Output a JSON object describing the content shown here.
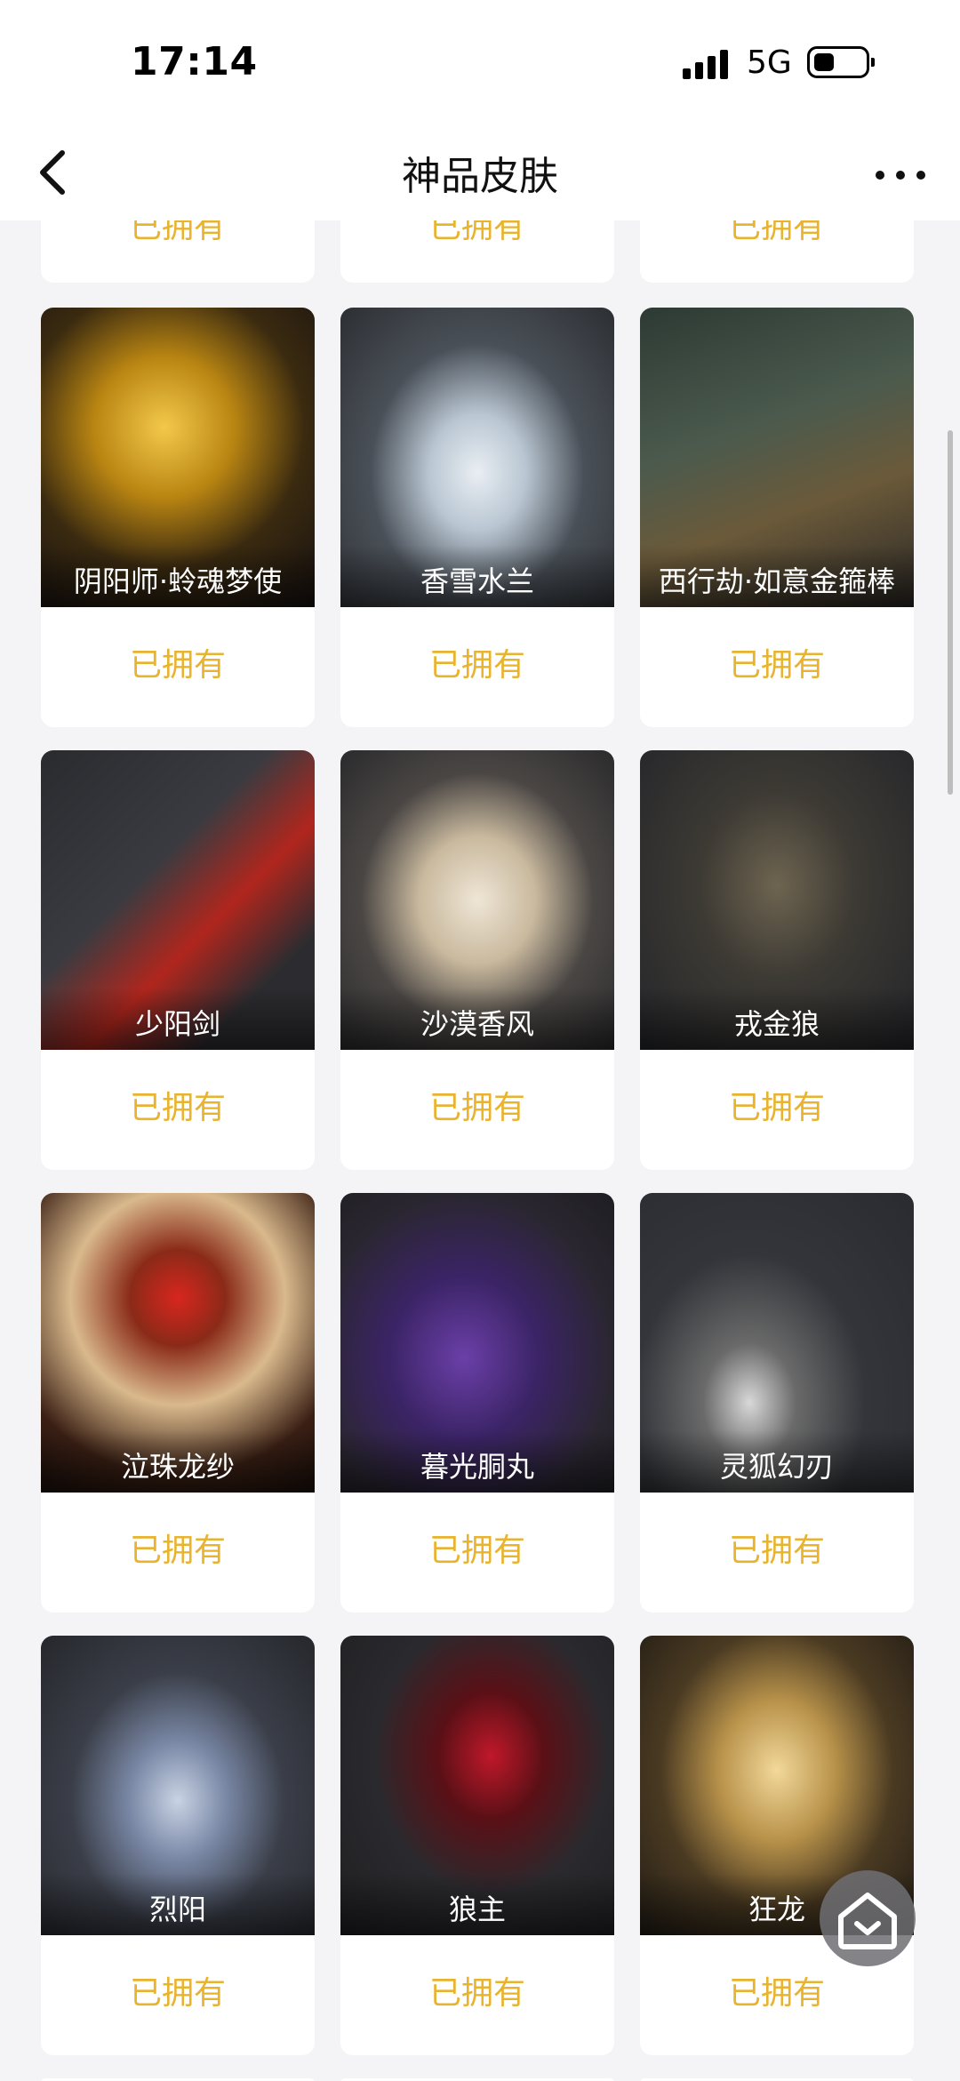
{
  "status_bar": {
    "time": "17:14",
    "network": "5G"
  },
  "nav": {
    "title": "神品皮肤"
  },
  "owned_label": "已拥有",
  "items": [
    {
      "name": "阴阳师·蛉魂梦使",
      "status": "已拥有"
    },
    {
      "name": "香雪水兰",
      "status": "已拥有"
    },
    {
      "name": "西行劫·如意金箍棒",
      "status": "已拥有"
    },
    {
      "name": "少阳剑",
      "status": "已拥有"
    },
    {
      "name": "沙漠香风",
      "status": "已拥有"
    },
    {
      "name": "戎金狼",
      "status": "已拥有"
    },
    {
      "name": "泣珠龙纱",
      "status": "已拥有"
    },
    {
      "name": "暮光胴丸",
      "status": "已拥有"
    },
    {
      "name": "灵狐幻刃",
      "status": "已拥有"
    },
    {
      "name": "烈阳",
      "status": "已拥有"
    },
    {
      "name": "狼主",
      "status": "已拥有"
    },
    {
      "name": "狂龙",
      "status": "已拥有"
    }
  ],
  "icons": {
    "back": "chevron-left-icon",
    "more": "more-horizontal-icon",
    "home": "home-icon",
    "signal": "signal-icon",
    "battery": "battery-icon"
  }
}
